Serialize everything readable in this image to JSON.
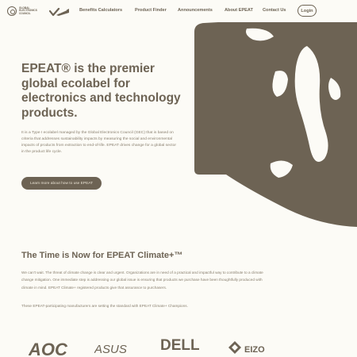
{
  "header": {
    "brand_lines": [
      "GLOBAL",
      "ELECTRONICS",
      "COUNCIL"
    ],
    "login_label": "Login"
  },
  "nav": {
    "items": [
      {
        "label": "Benefits Calculators"
      },
      {
        "label": "Product Finder"
      },
      {
        "label": "Announcements"
      },
      {
        "label": "About EPEAT"
      },
      {
        "label": "Contact Us"
      }
    ]
  },
  "hero": {
    "title": "EPEAT® is the premier global ecolabel for electronics and technology products.",
    "body": "It is a Type I ecolabel managed by the Global Electronics Council (GEC) that is based on criteria that addresses sustainability impacts by measuring the social and environmental impacts of products from extraction to end-of-life. EPEAT drives change for a global sector in the product life cycle.",
    "cta_label": "Learn more about how to use EPEAT"
  },
  "climate": {
    "title": "The Time is Now for EPEAT Climate+™",
    "body": "We can't wait. The threat of climate change is clear and urgent. Organizations are in need of a practical and impactful way to contribute to a climate change mitigation. One immediate step is addressing our global issue is ensuring that products we purchase have been thoughtfully produced with climate in mind. EPEAT Climate+ registered products give that assurance to purchasers.",
    "note": "These EPEAT-participating manufacturers are setting the standard with EPEAT Climate+ Champions."
  },
  "logos": [
    {
      "name": "AOC"
    },
    {
      "name": "ASUS"
    },
    {
      "name": "DELL"
    },
    {
      "name": "EIZO"
    }
  ],
  "colors": {
    "primary": "#6d6354",
    "background": "#fcfbf6",
    "cta_text": "#e8e2d3"
  }
}
